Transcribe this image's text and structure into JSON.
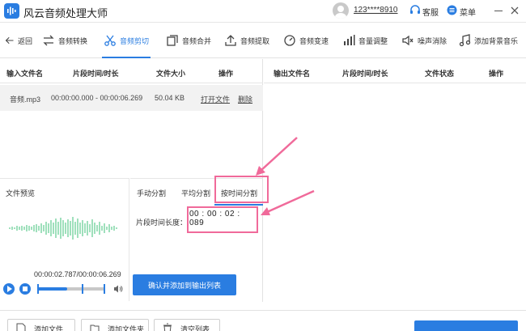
{
  "app": {
    "title": "风云音频处理大师",
    "user_phone": "123****8910",
    "customer_service": "客服",
    "menu": "菜单"
  },
  "toolbar": {
    "back": "返回",
    "items": [
      {
        "label": "音频转换"
      },
      {
        "label": "音频剪切"
      },
      {
        "label": "音频合并"
      },
      {
        "label": "音频提取"
      },
      {
        "label": "音频变速"
      },
      {
        "label": "音量调整"
      },
      {
        "label": "噪声消除"
      },
      {
        "label": "添加背景音乐"
      }
    ],
    "active": "音频剪切"
  },
  "input_table": {
    "columns": [
      "输入文件名",
      "片段时间/时长",
      "文件大小",
      "操作"
    ],
    "rows": [
      {
        "name": "音频.mp3",
        "time": "00:00:00.000 - 00:00:06.269",
        "size": "50.04 KB",
        "open": "打开文件",
        "delete": "删除"
      }
    ]
  },
  "output_table": {
    "columns": [
      "输出文件名",
      "片段时间/时长",
      "文件状态",
      "操作"
    ]
  },
  "preview": {
    "title": "文件预览",
    "time": "00:00:02.787/00:00:06.269",
    "progress": 0.44
  },
  "split": {
    "tabs": [
      "手动分割",
      "平均分割",
      "按时间分割"
    ],
    "active_tab": "按时间分割",
    "segment_label": "片段时间长度：",
    "segment_value": "00 : 00 : 02 : 089",
    "confirm": "确认并添加到输出列表"
  },
  "bottom": {
    "add_file": "添加文件",
    "add_folder": "添加文件夹",
    "clear_list": "清空列表"
  },
  "colors": {
    "accent": "#2a7de1",
    "highlight": "#f06a9a"
  }
}
